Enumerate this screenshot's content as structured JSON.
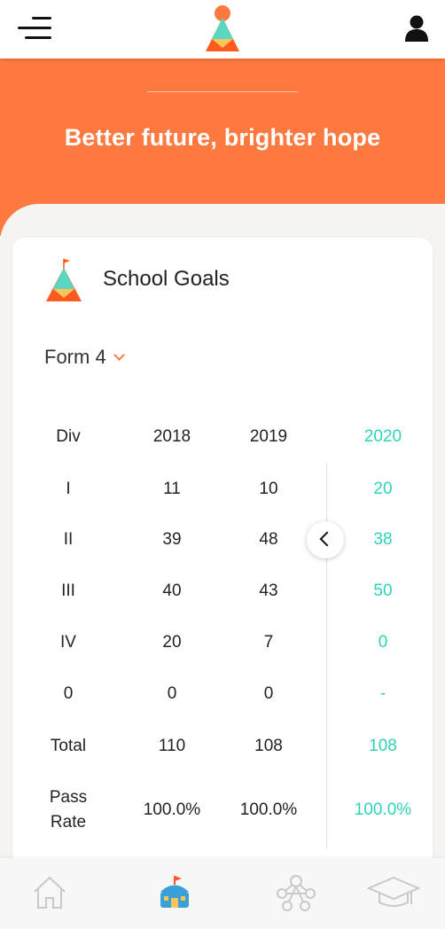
{
  "hero": {
    "title": "Better future, brighter hope"
  },
  "card": {
    "title": "School Goals",
    "form_selected": "Form 4"
  },
  "table": {
    "headers": [
      "Div",
      "2018",
      "2019",
      "2020"
    ],
    "rows": [
      [
        "I",
        "11",
        "10",
        "20"
      ],
      [
        "II",
        "39",
        "48",
        "38"
      ],
      [
        "III",
        "40",
        "43",
        "50"
      ],
      [
        "IV",
        "20",
        "7",
        "0"
      ],
      [
        "0",
        "0",
        "0",
        "-"
      ],
      [
        "Total",
        "110",
        "108",
        "108"
      ],
      [
        "Pass\nRate",
        "100.0%",
        "100.0%",
        "100.0%"
      ]
    ]
  },
  "icons": {
    "menu": "hamburger-menu-icon",
    "logo": "mountain-sun-logo",
    "user": "user-icon",
    "card_logo": "mountain-flag-logo",
    "dropdown": "chevron-down-icon",
    "scroll": "chevron-left-icon",
    "nav_home": "home-icon",
    "nav_school": "school-icon",
    "nav_network": "network-icon",
    "nav_graduation": "graduation-cap-icon"
  },
  "colors": {
    "accent": "#fe7940",
    "teal": "#2ed3b7",
    "active_nav": "#3aa0d8"
  }
}
